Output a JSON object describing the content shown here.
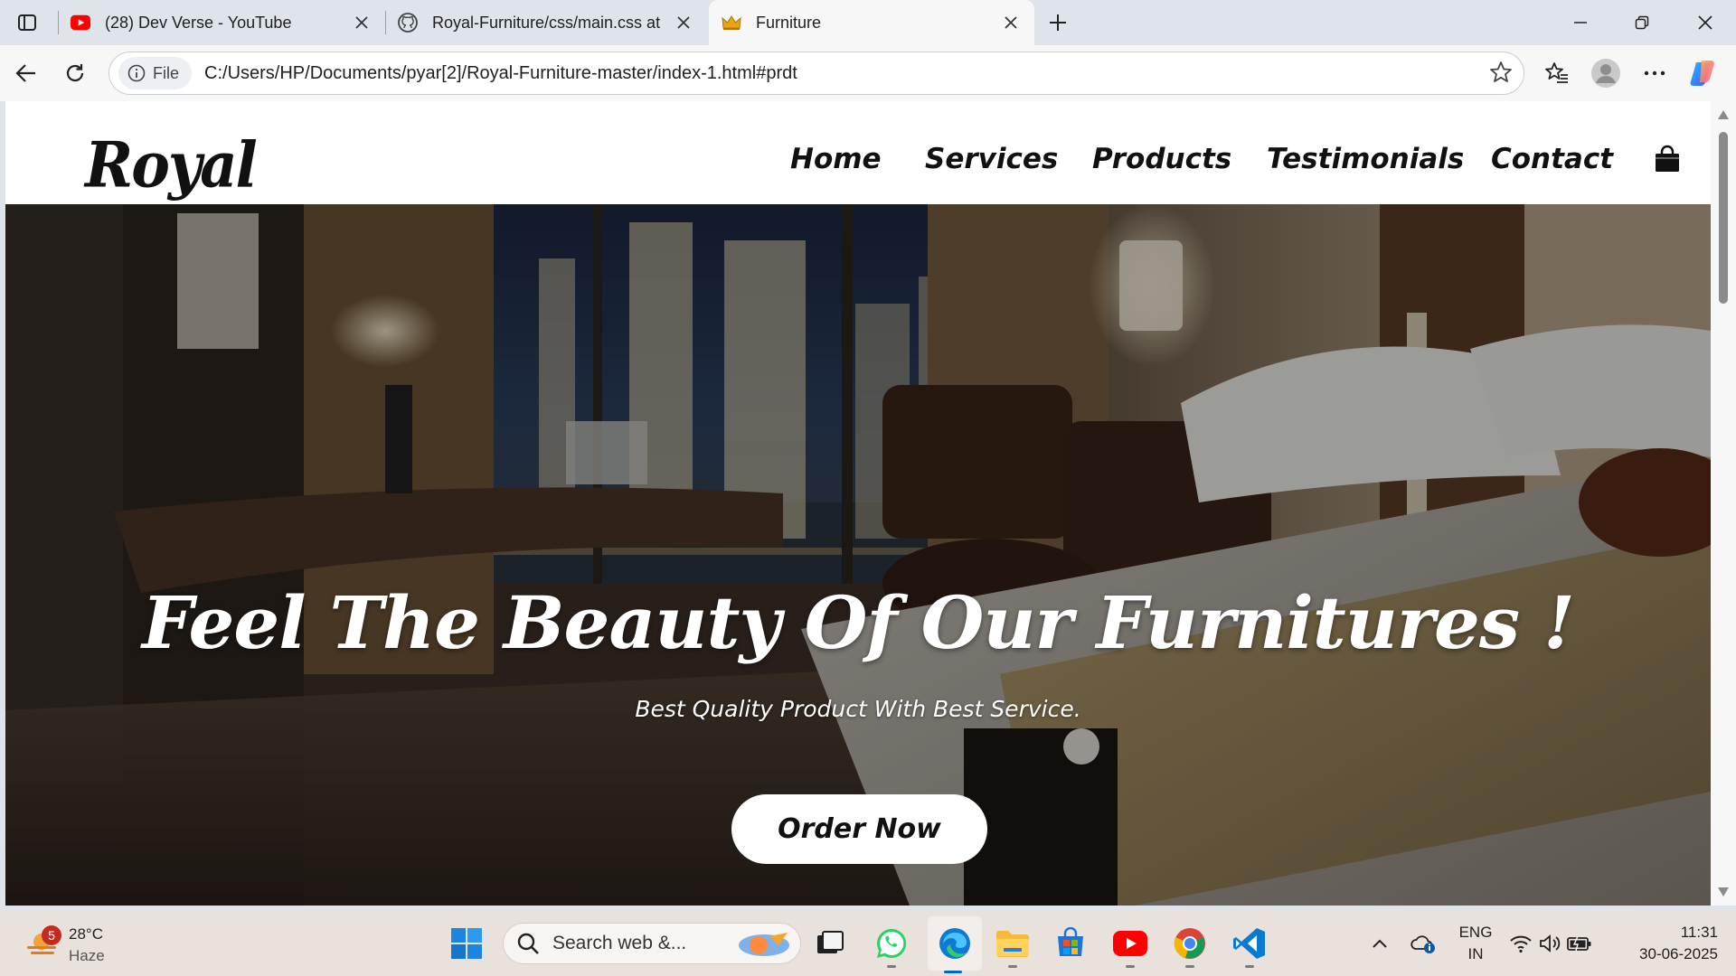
{
  "browser": {
    "tabs": [
      {
        "title": "(28) Dev Verse - YouTube",
        "favicon": "youtube-icon"
      },
      {
        "title": "Royal-Furniture/css/main.css at m",
        "favicon": "github-icon"
      },
      {
        "title": "Furniture",
        "favicon": "crown-icon",
        "active": true
      }
    ],
    "site_info_label": "File",
    "url": "C:/Users/HP/Documents/pyar[2]/Royal-Furniture-master/index-1.html#prdt"
  },
  "page": {
    "logo": "Royal",
    "nav": [
      "Home",
      "Services",
      "Products",
      "Testimonials",
      "Contact"
    ],
    "hero": {
      "title": "Feel The Beauty Of Our Furnitures !",
      "subtitle": "Best Quality Product With Best Service.",
      "cta": "Order Now"
    }
  },
  "taskbar": {
    "weather": {
      "badge": "5",
      "temp": "28°C",
      "condition": "Haze"
    },
    "search_placeholder": "Search web &...",
    "lang": {
      "line1": "ENG",
      "line2": "IN"
    },
    "clock": {
      "time": "11:31",
      "date": "30-06-2025"
    }
  },
  "colors": {
    "accent": "#0067c0",
    "youtube": "#ff0000",
    "page_text": "#111111"
  }
}
